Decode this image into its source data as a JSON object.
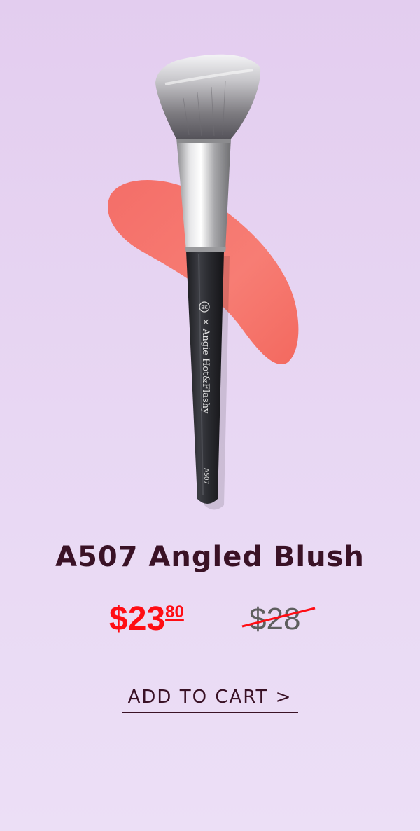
{
  "product": {
    "name": "A507 Angled Blush",
    "brush_imprint": "× Angie Hot&Flashy",
    "brush_model": "A507",
    "brand_logo": "BK"
  },
  "price": {
    "sale_dollars": "$23",
    "sale_cents": "80",
    "original": "$28"
  },
  "cta": {
    "label": "ADD TO CART >"
  },
  "colors": {
    "background": "#e5d2f1",
    "sale_price": "#ff0d14",
    "text": "#3a1226",
    "swatch": "#f4716a"
  }
}
